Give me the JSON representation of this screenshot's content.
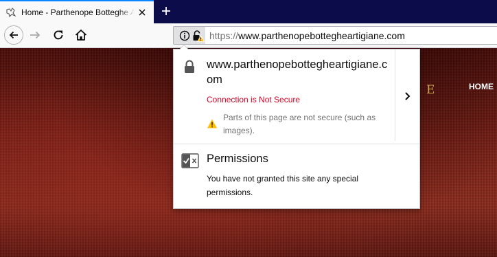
{
  "tab": {
    "title": "Home - Parthenope Botteghe Artigiane",
    "favicon_icon": "site-logo-icon",
    "close_icon": "close-icon"
  },
  "new_tab": {
    "icon": "plus-icon"
  },
  "nav": {
    "back_icon": "arrow-left-icon",
    "forward_icon": "arrow-right-icon",
    "reload_icon": "reload-icon",
    "home_icon": "home-icon"
  },
  "urlbar": {
    "scheme": "https://",
    "host": "www.parthenopebottegheartigiane.com",
    "info_icon": "info-icon",
    "security_icon": "lock-warning-icon"
  },
  "page": {
    "logo_letter": "E",
    "nav_home": "HOME"
  },
  "popup": {
    "host": "www.parthenopebottegheartigiane.com",
    "connection_status": "Connection is Not Secure",
    "mixed_content": "Parts of this page are not secure (such as images).",
    "permissions_title": "Permissions",
    "permissions_desc": "You have not granted this site any special permissions.",
    "colors": {
      "insecure": "#d70022",
      "warning": "#ffbf00",
      "accent": "#0a84ff",
      "tabstrip": "#0c0c4a"
    }
  }
}
